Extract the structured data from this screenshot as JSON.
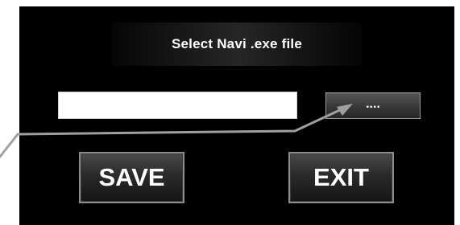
{
  "dialog": {
    "title": "Select Navi .exe file",
    "path_input": {
      "value": "",
      "placeholder": ""
    },
    "browse_label": "....",
    "save_label": "SAVE",
    "exit_label": "EXIT"
  },
  "annotation": {
    "icon": "callout-arrow-icon",
    "color": "#a0a0a0"
  },
  "colors": {
    "background": "#000000",
    "text": "#ffffff",
    "input_background": "#ffffff"
  }
}
